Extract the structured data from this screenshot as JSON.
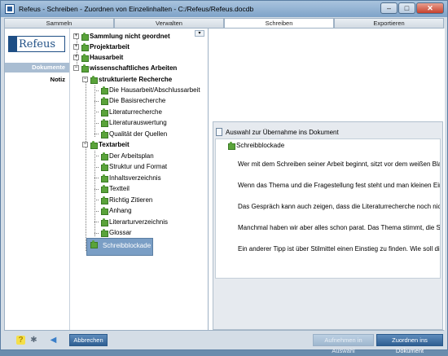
{
  "window": {
    "title": "Refeus - Schreiben - Zuordnen von Einzelinhalten - C:/Refeus/Refeus.docdb",
    "minimize": "–",
    "maximize": "□",
    "close": "✕"
  },
  "tabs": [
    {
      "label": "Sammeln"
    },
    {
      "label": "Verwalten"
    },
    {
      "label": "Schreiben"
    },
    {
      "label": "Exportieren"
    }
  ],
  "sidebar": {
    "logo": "Refeus",
    "items": [
      {
        "label": "Dokumente"
      },
      {
        "label": "Notiz"
      }
    ]
  },
  "tree": {
    "collapse_glyph": "▾",
    "expanded_glyph": "−",
    "nodes": [
      {
        "label": "Sammlung nicht geordnet"
      },
      {
        "label": "Projektarbeit"
      },
      {
        "label": "Hausarbeit"
      },
      {
        "label": "wissenschaftliches Arbeiten"
      },
      {
        "label": "strukturierte Recherche"
      },
      {
        "label": "Die Hausarbeit/Abschlussarbeit"
      },
      {
        "label": "Die Basisrecherche"
      },
      {
        "label": "Literaturrecherche"
      },
      {
        "label": "Literaturauswertung"
      },
      {
        "label": "Qualität der Quellen"
      },
      {
        "label": "Textarbeit"
      },
      {
        "label": "Der Arbeitsplan"
      },
      {
        "label": "Struktur und Format"
      },
      {
        "label": "Inhaltsverzeichnis"
      },
      {
        "label": "Textteil"
      },
      {
        "label": "Richtig Zitieren"
      },
      {
        "label": "Anhang"
      },
      {
        "label": "Literarturverzeichnis"
      },
      {
        "label": "Glossar"
      },
      {
        "label": "Schreibblockade"
      }
    ]
  },
  "selection": {
    "header": "Auswahl zur Übernahme ins Dokument",
    "item": "Schreibblockade",
    "paragraphs": [
      "Wer mit dem Schreiben seiner Arbeit beginnt, sitzt vor dem weißen Bla",
      "Wenn das Thema und die Fragestellung fest steht und man kleinen Ein",
      "Das Gespräch kann auch zeigen, dass die Literaturrecherche noch nic",
      "Manchmal haben wir aber alles schon parat. Das Thema stimmt, die S",
      "Ein anderer Tipp ist über Stilmittel einen Einstieg zu finden. Wie soll di"
    ]
  },
  "bottom": {
    "help_icon": "?",
    "settings_icon": "✱",
    "back_icon": "◀",
    "cancel": "Abbrechen",
    "add_to_selection": "Aufnehmen in Auswahl",
    "assign_to_document": "Zuordnen ins Dokument"
  }
}
